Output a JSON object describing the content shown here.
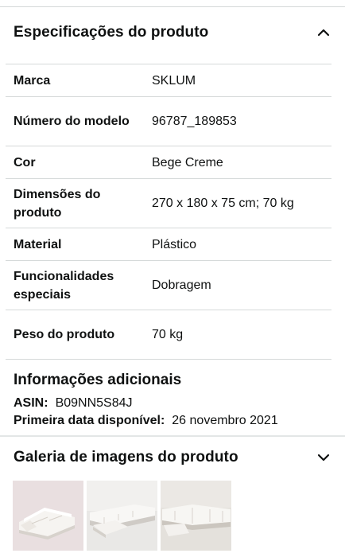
{
  "specs": {
    "title": "Especificações do produto",
    "rows": [
      {
        "key": "Marca",
        "value": "SKLUM"
      },
      {
        "key": "Número do modelo",
        "value": "96787_189853"
      },
      {
        "key": "Cor",
        "value": "Bege Creme"
      },
      {
        "key": "Dimensões do produto",
        "value": "270 x 180 x 75 cm; 70 kg"
      },
      {
        "key": "Material",
        "value": "Plástico"
      },
      {
        "key": "Funcionalidades especiais",
        "value": "Dobragem"
      },
      {
        "key": "Peso do produto",
        "value": "70 kg"
      }
    ]
  },
  "additional": {
    "title": "Informações adicionais",
    "asin_label": "ASIN:",
    "asin_value": "B09NN5S84J",
    "date_label": "Primeira data disponível:",
    "date_value": "26 novembro 2021"
  },
  "gallery": {
    "title": "Galeria de imagens do produto",
    "thumbnails": [
      "sofa-thumb-1",
      "sofa-thumb-2",
      "sofa-thumb-3"
    ]
  },
  "colors": {
    "text": "#0f1111",
    "divider": "#d5d9d9",
    "selected_thumb_bg": "#e9dfe0"
  }
}
